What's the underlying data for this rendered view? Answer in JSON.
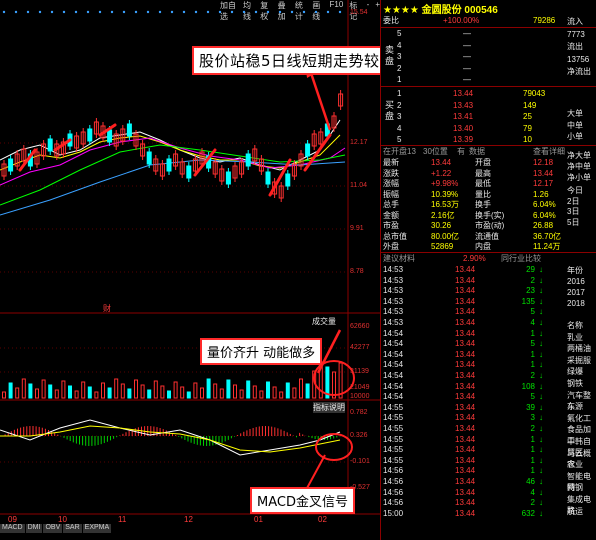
{
  "toolbar": {
    "items": [
      "加自选",
      "均线",
      "复权",
      "叠加",
      "统计",
      "画线",
      "F10",
      "标记",
      "-",
      "+"
    ]
  },
  "stock": {
    "stars": "★★★★",
    "name": "金圆股份",
    "code": "000546"
  },
  "main_chart": {
    "price_ticks": [
      "15.54",
      "12.17",
      "11.04",
      "9.91",
      "8.78"
    ],
    "annotation": "股价站稳5日线短期走势较强",
    "label_cai": "财",
    "volume_label": "成交量"
  },
  "volume_chart": {
    "ticks": [
      "62660",
      "42277",
      "31139",
      "21049",
      "10000"
    ],
    "annotation": "量价齐升  动能做多",
    "indicator_label": "指标说明"
  },
  "macd_chart": {
    "ticks": [
      "0.782",
      "0.326",
      "-0.101",
      "-0.527"
    ],
    "annotation": "MACD金叉信号"
  },
  "x_axis": [
    "09",
    "10",
    "11",
    "12",
    "01",
    "02"
  ],
  "bottom_tabs": [
    "MACD",
    "DMI",
    "OBV",
    "SAR",
    "EXPMA"
  ],
  "quote": {
    "weibi_label": "委比",
    "weibi": "+100.00%",
    "weicha": "79286",
    "sell": [
      {
        "label": "5",
        "price": "—",
        "vol": ""
      },
      {
        "label": "4",
        "price": "—",
        "vol": ""
      },
      {
        "label": "3",
        "price": "—",
        "vol": ""
      },
      {
        "label": "2",
        "price": "—",
        "vol": ""
      },
      {
        "label": "1",
        "price": "—",
        "vol": ""
      }
    ],
    "sell_side_label": "卖盘",
    "buy_side_label": "买盘",
    "buy": [
      {
        "label": "1",
        "price": "13.44",
        "vol": "79043"
      },
      {
        "label": "2",
        "price": "13.43",
        "vol": "149"
      },
      {
        "label": "3",
        "price": "13.41",
        "vol": "25"
      },
      {
        "label": "4",
        "price": "13.40",
        "vol": "79"
      },
      {
        "label": "5",
        "price": "13.39",
        "vol": "10"
      }
    ],
    "tabs": [
      "在开盘13",
      "30位置",
      "有",
      "数据",
      "查看详细"
    ],
    "stats": [
      {
        "l1": "最新",
        "v1": "13.44",
        "l2": "开盘",
        "v2": "12.18"
      },
      {
        "l1": "涨跌",
        "v1": "+1.22",
        "l2": "最高",
        "v2": "13.44"
      },
      {
        "l1": "涨幅",
        "v1": "+9.98%",
        "l2": "最低",
        "v2": "12.17"
      },
      {
        "l1": "振幅",
        "v1": "10.39%",
        "l2": "量比",
        "v2": "1.26"
      },
      {
        "l1": "总手",
        "v1": "16.53万",
        "l2": "换手",
        "v2": "6.04%"
      },
      {
        "l1": "金额",
        "v1": "2.16亿",
        "l2": "换手(实)",
        "v2": "6.04%"
      },
      {
        "l1": "市盈",
        "v1": "30.26",
        "l2": "市盈(动)",
        "v2": "26.88"
      },
      {
        "l1": "总市值",
        "v1": "80.00亿",
        "l2": "流通值",
        "v2": "36.70亿"
      },
      {
        "l1": "外盘",
        "v1": "52869",
        "l2": "内盘",
        "v2": "11.24万"
      }
    ],
    "trade_header": [
      "建议材料",
      "2.90%",
      "同行业比较"
    ],
    "trades": [
      {
        "t": "14:53",
        "p": "13.44",
        "v": "29",
        "d": "down"
      },
      {
        "t": "14:53",
        "p": "13.44",
        "v": "2",
        "d": "down"
      },
      {
        "t": "14:53",
        "p": "13.44",
        "v": "23",
        "d": "down"
      },
      {
        "t": "14:53",
        "p": "13.44",
        "v": "135",
        "d": "down"
      },
      {
        "t": "14:53",
        "p": "13.44",
        "v": "5",
        "d": "down"
      },
      {
        "t": "14:53",
        "p": "13.44",
        "v": "4",
        "d": "down"
      },
      {
        "t": "14:54",
        "p": "13.44",
        "v": "1",
        "d": "down"
      },
      {
        "t": "14:54",
        "p": "13.44",
        "v": "5",
        "d": "down"
      },
      {
        "t": "14:54",
        "p": "13.44",
        "v": "1",
        "d": "down"
      },
      {
        "t": "14:54",
        "p": "13.44",
        "v": "1",
        "d": "down"
      },
      {
        "t": "14:54",
        "p": "13.44",
        "v": "2",
        "d": "down"
      },
      {
        "t": "14:54",
        "p": "13.44",
        "v": "108",
        "d": "down"
      },
      {
        "t": "14:54",
        "p": "13.44",
        "v": "5",
        "d": "down"
      },
      {
        "t": "14:55",
        "p": "13.44",
        "v": "39",
        "d": "down"
      },
      {
        "t": "14:55",
        "p": "13.44",
        "v": "3",
        "d": "down"
      },
      {
        "t": "14:55",
        "p": "13.44",
        "v": "2",
        "d": "down"
      },
      {
        "t": "14:55",
        "p": "13.44",
        "v": "1",
        "d": "down"
      },
      {
        "t": "14:55",
        "p": "13.44",
        "v": "1",
        "d": "down"
      },
      {
        "t": "14:55",
        "p": "13.44",
        "v": "1",
        "d": "down"
      },
      {
        "t": "14:56",
        "p": "13.44",
        "v": "1",
        "d": "down"
      },
      {
        "t": "14:56",
        "p": "13.44",
        "v": "46",
        "d": "down"
      },
      {
        "t": "14:56",
        "p": "13.44",
        "v": "4",
        "d": "down"
      },
      {
        "t": "14:56",
        "p": "13.44",
        "v": "2",
        "d": "down"
      },
      {
        "t": "15:00",
        "p": "13.44",
        "v": "632",
        "d": "down"
      }
    ],
    "side_top": [
      "流入",
      "7773",
      "流出",
      "13756",
      "净流出"
    ],
    "side_big": [
      "大单",
      "中单",
      "小单"
    ],
    "side_flow": [
      "净大单",
      "净中单",
      "净小单"
    ],
    "side_days": [
      "今日",
      "2日",
      "3日",
      "5日"
    ],
    "side_year": [
      "年份",
      "2016",
      "2017",
      "2018"
    ],
    "side_names": [
      "名称",
      "乳业",
      "两桶油",
      "采掘服",
      "绿爆",
      "钢铁",
      "汽车整车",
      "东源",
      "氟化工",
      "食品加工",
      "中韩自贸区",
      "马云概念",
      "农业",
      "智能电网",
      "特钢",
      "集成电路",
      "航运"
    ]
  }
}
